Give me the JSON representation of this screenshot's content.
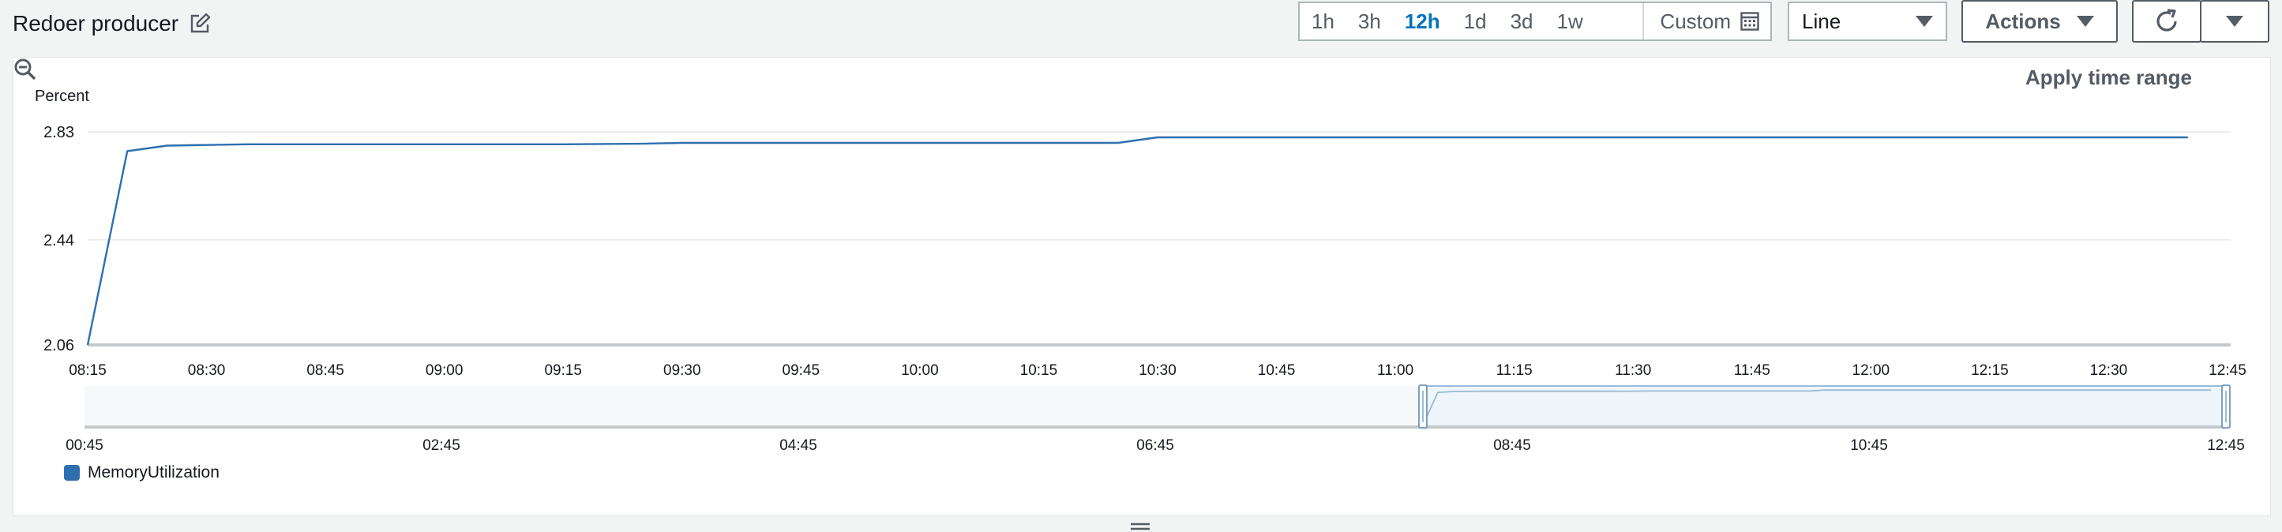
{
  "header": {
    "title": "Redoer producer",
    "edit_icon": "edit-icon"
  },
  "time_ranges": [
    {
      "label": "1h",
      "active": false
    },
    {
      "label": "3h",
      "active": false
    },
    {
      "label": "12h",
      "active": true
    },
    {
      "label": "1d",
      "active": false
    },
    {
      "label": "3d",
      "active": false
    },
    {
      "label": "1w",
      "active": false
    }
  ],
  "custom_label": "Custom",
  "graph_type": "Line",
  "actions_label": "Actions",
  "refresh_icon": "refresh-icon",
  "panel": {
    "apply_label": "Apply time range",
    "zoom_icon": "zoom-out-icon"
  },
  "colors": {
    "series": "#2e6fb0",
    "accent": "#0073bb"
  },
  "chart_data": {
    "type": "line",
    "ylabel": "Percent",
    "y_ticks": [
      "2.83",
      "2.44",
      "2.06"
    ],
    "ylim": [
      2.06,
      2.83
    ],
    "x_ticks": [
      "08:15",
      "08:30",
      "08:45",
      "09:00",
      "09:15",
      "09:30",
      "09:45",
      "10:00",
      "10:15",
      "10:30",
      "10:45",
      "11:00",
      "11:15",
      "11:30",
      "11:45",
      "12:00",
      "12:15",
      "12:30",
      "12:45"
    ],
    "x_range": [
      "08:15",
      "12:45"
    ],
    "grid": true,
    "series": [
      {
        "name": "MemoryUtilization",
        "x": [
          "08:15",
          "08:20",
          "08:25",
          "08:35",
          "08:50",
          "09:15",
          "09:25",
          "09:30",
          "10:20",
          "10:25",
          "10:30",
          "10:50",
          "12:40"
        ],
        "values": [
          2.06,
          2.76,
          2.78,
          2.785,
          2.785,
          2.785,
          2.787,
          2.79,
          2.79,
          2.79,
          2.81,
          2.81,
          2.81
        ]
      }
    ],
    "overview": {
      "x_ticks": [
        "00:45",
        "02:45",
        "04:45",
        "06:45",
        "08:45",
        "10:45",
        "12:45"
      ],
      "selection": [
        "08:15",
        "12:45"
      ]
    }
  }
}
